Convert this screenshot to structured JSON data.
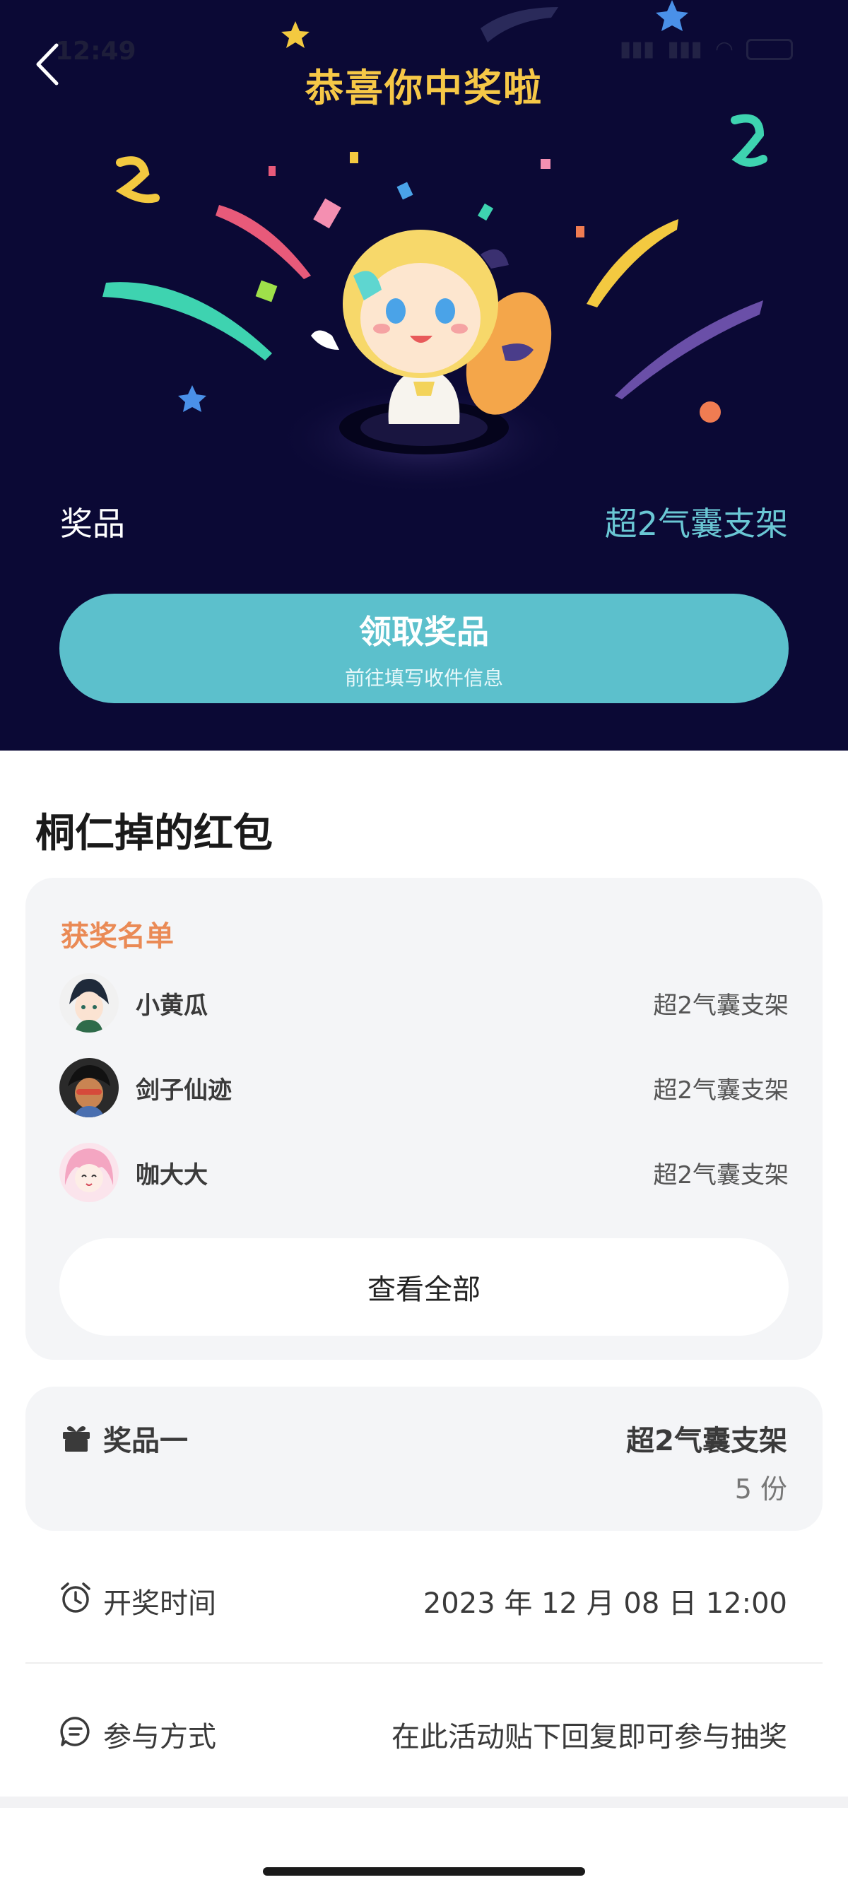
{
  "status_bar": {
    "time": "12:49"
  },
  "hero": {
    "title": "恭喜你中奖啦",
    "prize_label": "奖品",
    "prize_value": "超2气囊支架",
    "claim_button": {
      "title": "领取奖品",
      "subtitle": "前往填写收件信息"
    }
  },
  "post": {
    "title": "桐仁掉的红包"
  },
  "winners": {
    "heading": "获奖名单",
    "rows": [
      {
        "name": "小黄瓜",
        "prize": "超2气囊支架"
      },
      {
        "name": "剑子仙迹",
        "prize": "超2气囊支架"
      },
      {
        "name": "咖大大",
        "prize": "超2气囊支架"
      }
    ],
    "view_all_label": "查看全部"
  },
  "prize_item": {
    "label": "奖品一",
    "name": "超2气囊支架",
    "quantity": "5 份"
  },
  "draw_time": {
    "label": "开奖时间",
    "value": "2023 年 12 月 08 日 12:00"
  },
  "participation": {
    "label": "参与方式",
    "value": "在此活动贴下回复即可参与抽奖"
  },
  "colors": {
    "hero_bg": "#0b0935",
    "accent_teal": "#5cc0cc",
    "title_gold": "#f6c847",
    "winners_heading": "#ea8a55"
  }
}
